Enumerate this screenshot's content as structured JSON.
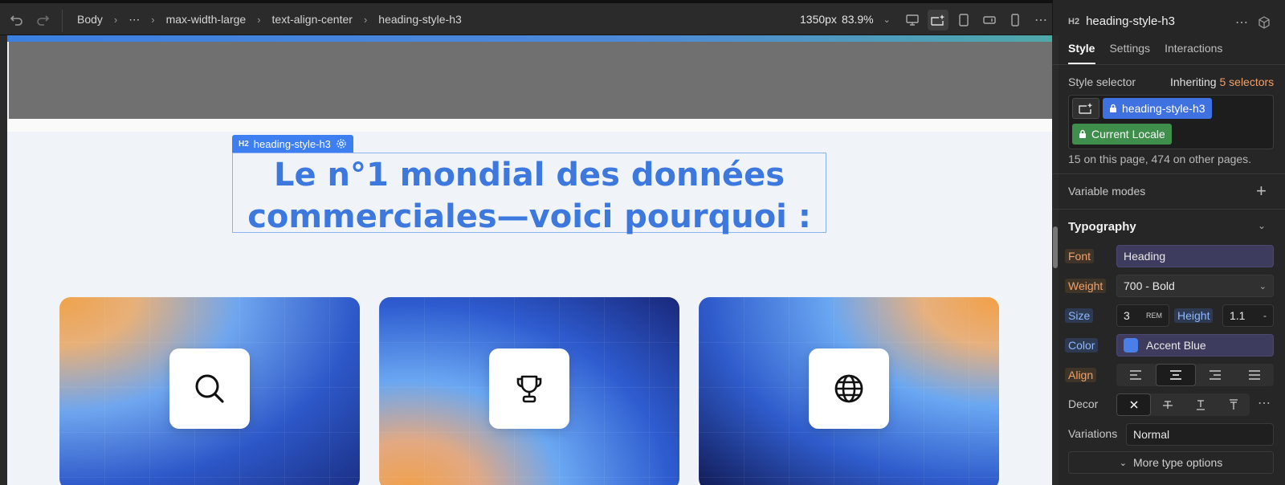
{
  "breadcrumbs": [
    "Body",
    "⋯",
    "max-width-large",
    "text-align-center",
    "heading-style-h3"
  ],
  "viewport": {
    "width_label": "1350px",
    "zoom": "83.9%"
  },
  "canvas": {
    "element_tag": {
      "type": "H2",
      "label": "heading-style-h3"
    },
    "heading_line1": "Le n°1 mondial des données",
    "heading_line2": "commerciales—voici pourquoi :",
    "cards": [
      {
        "icon": "search-icon"
      },
      {
        "icon": "trophy-icon"
      },
      {
        "icon": "globe-icon"
      }
    ]
  },
  "panel": {
    "element_type": "H2",
    "element_name": "heading-style-h3",
    "tabs": [
      "Style",
      "Settings",
      "Interactions"
    ],
    "style_selector_label": "Style selector",
    "inheriting_prefix": "Inheriting",
    "inheriting_count": "5 selectors",
    "selector_chip": "heading-style-h3",
    "locale_chip": "Current Locale",
    "usage_note": "15 on this page, 474 on other pages.",
    "variable_modes": "Variable modes",
    "typography_title": "Typography",
    "font_label": "Font",
    "font_value": "Heading",
    "weight_label": "Weight",
    "weight_value": "700 - Bold",
    "size_label": "Size",
    "size_value": "3",
    "size_unit": "REM",
    "height_label": "Height",
    "height_value": "1.1",
    "height_unit": "-",
    "color_label": "Color",
    "color_value": "Accent Blue",
    "color_swatch": "#4a7fe8",
    "align_label": "Align",
    "decor_label": "Decor",
    "variations_label": "Variations",
    "variations_value": "Normal",
    "more_options": "More type options"
  }
}
